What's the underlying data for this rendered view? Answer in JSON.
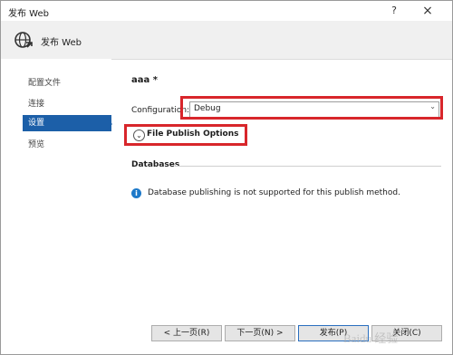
{
  "window": {
    "title": "发布 Web",
    "help_glyph": "?",
    "close_glyph": "×"
  },
  "header": {
    "title": "发布 Web",
    "icon": "globe-publish-icon"
  },
  "nav": {
    "items": [
      {
        "label": "配置文件"
      },
      {
        "label": "连接"
      },
      {
        "label": "设置",
        "active": true
      },
      {
        "label": "预览"
      }
    ]
  },
  "settings": {
    "profile_name": "aaa *",
    "configuration_label": "Configuration:",
    "configuration_value": "Debug",
    "file_publish_options_label": "File Publish Options",
    "databases_heading": "Databases",
    "info_message": "Database publishing is not supported for this publish method."
  },
  "footer": {
    "prev_label": "< 上一页(R)",
    "next_label": "下一页(N) >",
    "publish_label": "发布(P)",
    "close_label": "关闭(C)"
  },
  "watermark": {
    "text": "Baidu 经验"
  },
  "colors": {
    "accent": "#1c5fa8",
    "highlight": "#d8262b",
    "info": "#1d79c9"
  }
}
